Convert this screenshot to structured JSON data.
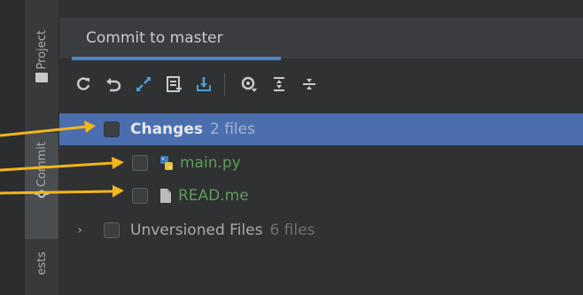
{
  "sidebar": {
    "tabs": [
      {
        "label": "Project",
        "icon": "folder-icon"
      },
      {
        "label": "Commit",
        "icon": "commit-icon"
      },
      {
        "label": "ests",
        "icon": ""
      }
    ]
  },
  "panel": {
    "tab_label": "Commit to master"
  },
  "toolbar": {
    "buttons": [
      "refresh-icon",
      "rollback-icon",
      "diff-icon",
      "changelist-icon",
      "shelve-icon",
      "view-options-icon",
      "expand-all-icon",
      "collapse-all-icon"
    ]
  },
  "tree": {
    "changes": {
      "label": "Changes",
      "count": "2 files"
    },
    "files": [
      {
        "name": "main.py",
        "icon": "python-file-icon"
      },
      {
        "name": "READ.me",
        "icon": "text-file-icon"
      }
    ],
    "unversioned": {
      "label": "Unversioned Files",
      "count": "6 files"
    }
  },
  "colors": {
    "accent": "#4a88c7",
    "selection": "#4b6eaf",
    "added_file": "#5f9c5a",
    "annotation": "#f2b51b"
  }
}
